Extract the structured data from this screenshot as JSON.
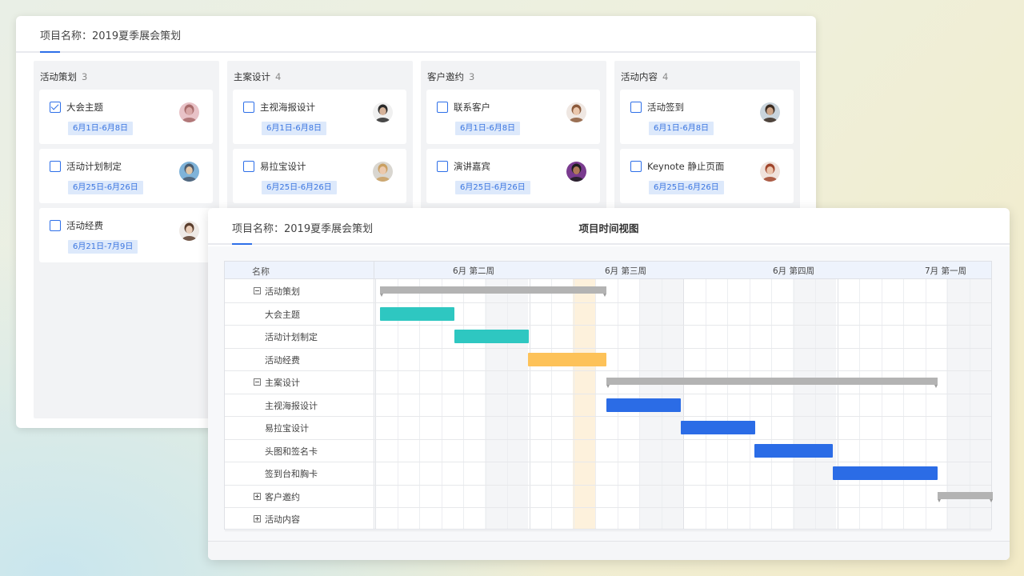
{
  "board": {
    "project_title": "项目名称：2019夏季展会策划",
    "columns": [
      {
        "name": "活动策划",
        "count": "3",
        "cards": [
          {
            "title": "大会主题",
            "date": "6月1日-6月8日",
            "checked": true,
            "avatar": "pink"
          },
          {
            "title": "活动计划制定",
            "date": "6月25日-6月26日",
            "checked": false,
            "avatar": "sky"
          },
          {
            "title": "活动经费",
            "date": "6月21日-7月9日",
            "checked": false,
            "avatar": "light"
          }
        ]
      },
      {
        "name": "主案设计",
        "count": "4",
        "cards": [
          {
            "title": "主视海报设计",
            "date": "6月1日-6月8日",
            "checked": false,
            "avatar": "man"
          },
          {
            "title": "易拉宝设计",
            "date": "6月25日-6月26日",
            "checked": false,
            "avatar": "blonde"
          }
        ]
      },
      {
        "name": "客户邀约",
        "count": "3",
        "cards": [
          {
            "title": "联系客户",
            "date": "6月1日-6月8日",
            "checked": false,
            "avatar": "woman"
          },
          {
            "title": "演讲嘉宾",
            "date": "6月25日-6月26日",
            "checked": false,
            "avatar": "purple"
          }
        ]
      },
      {
        "name": "活动内容",
        "count": "4",
        "cards": [
          {
            "title": "活动签到",
            "date": "6月1日-6月8日",
            "checked": false,
            "avatar": "beard"
          },
          {
            "title": "Keynote 静止页面",
            "date": "6月25日-6月26日",
            "checked": false,
            "avatar": "red"
          }
        ]
      }
    ]
  },
  "gantt": {
    "project_title": "项目名称：2019夏季展会策划",
    "view_title": "项目时间视图",
    "name_header": "名称",
    "weeks": [
      "6月 第二周",
      "6月 第三周",
      "6月 第四周",
      "7月 第一周"
    ],
    "rows": [
      {
        "name": "活动策划",
        "type": "group",
        "toggle": "minus",
        "start": 0,
        "end": 5.2
      },
      {
        "name": "大会主题",
        "type": "task",
        "start": 0,
        "end": 1.7,
        "color": "#2ec7c1"
      },
      {
        "name": "活动计划制定",
        "type": "task",
        "start": 1.7,
        "end": 3.4,
        "color": "#2ec7c1"
      },
      {
        "name": "活动经费",
        "type": "task",
        "start": 3.4,
        "end": 5.2,
        "color": "#fdc259"
      },
      {
        "name": "主案设计",
        "type": "group",
        "toggle": "minus",
        "start": 5.2,
        "end": 12.8
      },
      {
        "name": "主视海报设计",
        "type": "task",
        "start": 5.2,
        "end": 6.9,
        "color": "#2b6ce6"
      },
      {
        "name": "易拉宝设计",
        "type": "task",
        "start": 6.9,
        "end": 8.6,
        "color": "#2b6ce6"
      },
      {
        "name": "头图和签名卡",
        "type": "task",
        "start": 8.6,
        "end": 10.4,
        "color": "#2b6ce6"
      },
      {
        "name": "签到台和胸卡",
        "type": "task",
        "start": 10.4,
        "end": 12.8,
        "color": "#2b6ce6"
      },
      {
        "name": "客户邀约",
        "type": "group",
        "toggle": "plus",
        "start": 12.8,
        "end": 14.2
      },
      {
        "name": "活动内容",
        "type": "group",
        "toggle": "plus"
      }
    ]
  },
  "colors": {
    "accent": "#2e6fe8",
    "teal": "#2ec7c1",
    "orange": "#fdc259",
    "blue": "#2b6ce6",
    "gray": "#b3b3b3"
  }
}
